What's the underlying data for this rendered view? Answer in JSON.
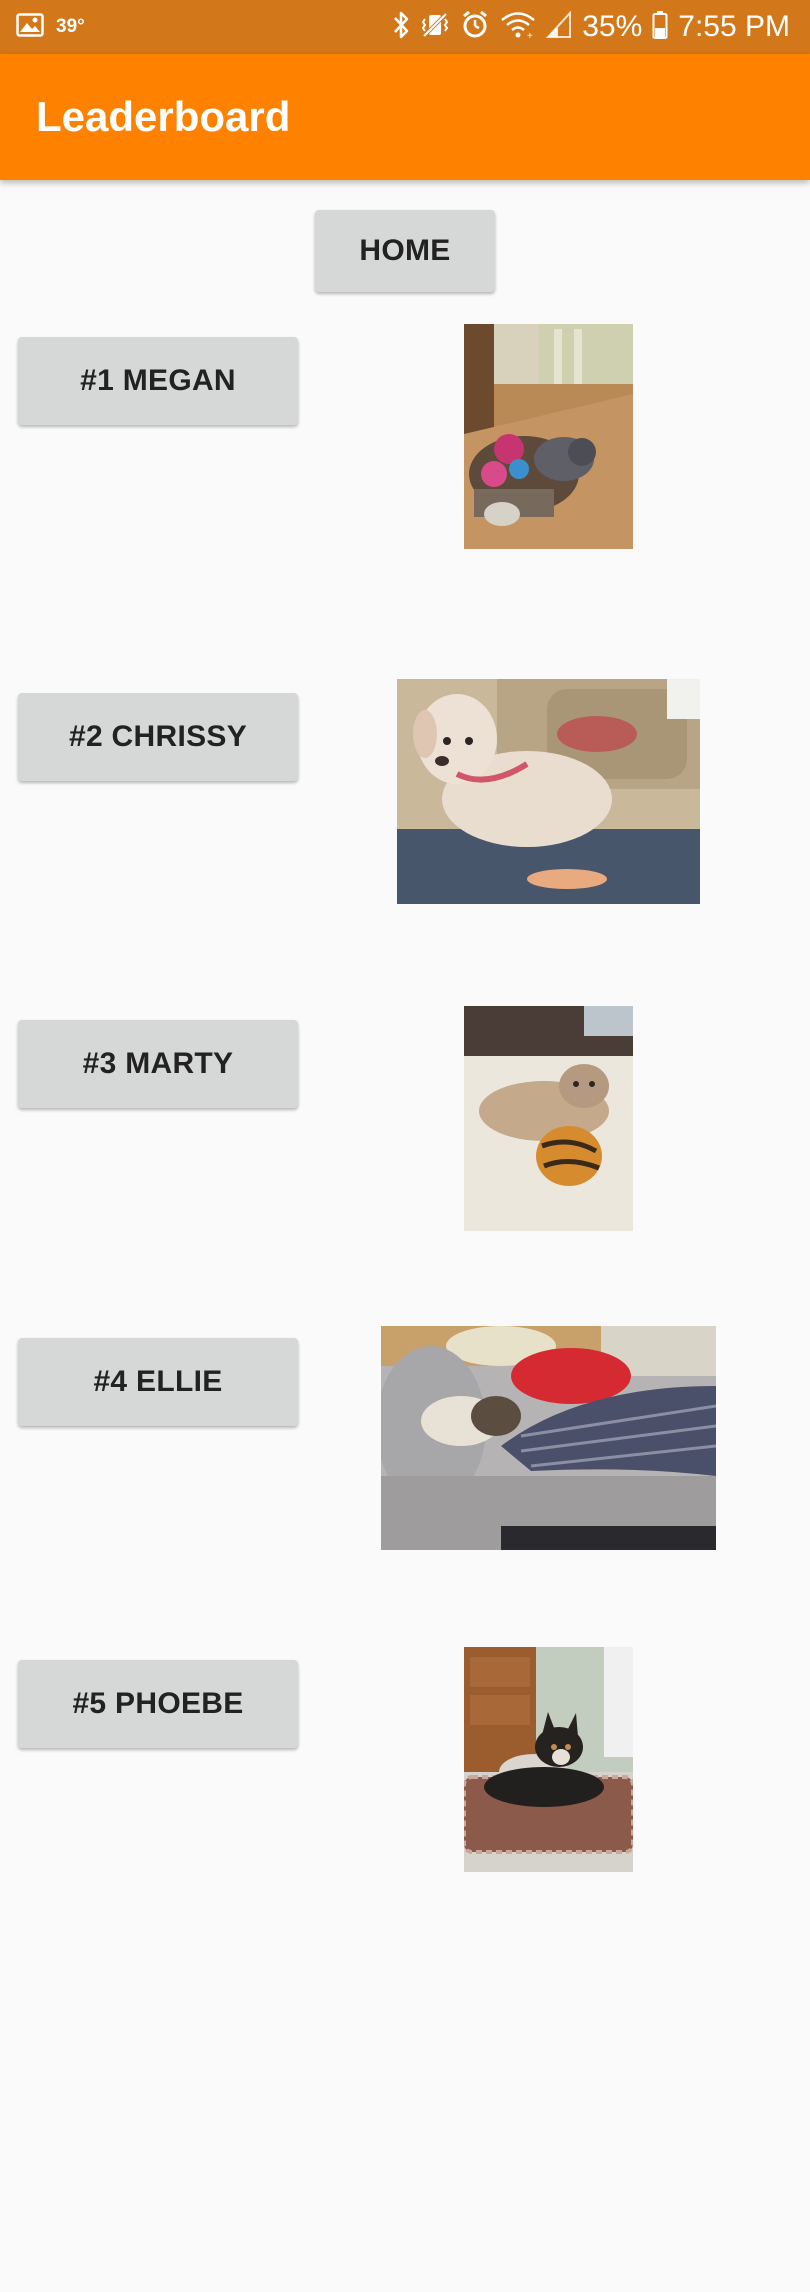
{
  "status_bar": {
    "temperature": "39°",
    "battery": "35%",
    "time": "7:55 PM",
    "icons": [
      "gallery-icon",
      "bluetooth-icon",
      "vibrate-icon",
      "alarm-icon",
      "wifi-icon",
      "signal-icon",
      "battery-icon"
    ]
  },
  "app_bar": {
    "title": "Leaderboard",
    "color": "#ff8100"
  },
  "home_button": {
    "label": "HOME"
  },
  "leaderboard": [
    {
      "label": "#1 MEGAN",
      "photo": "dog-photo-megan"
    },
    {
      "label": "#2 CHRISSY",
      "photo": "dog-photo-chrissy"
    },
    {
      "label": "#3 MARTY",
      "photo": "dog-photo-marty"
    },
    {
      "label": "#4 ELLIE",
      "photo": "dog-photo-ellie"
    },
    {
      "label": "#5 PHOEBE",
      "photo": "dog-photo-phoebe"
    }
  ]
}
